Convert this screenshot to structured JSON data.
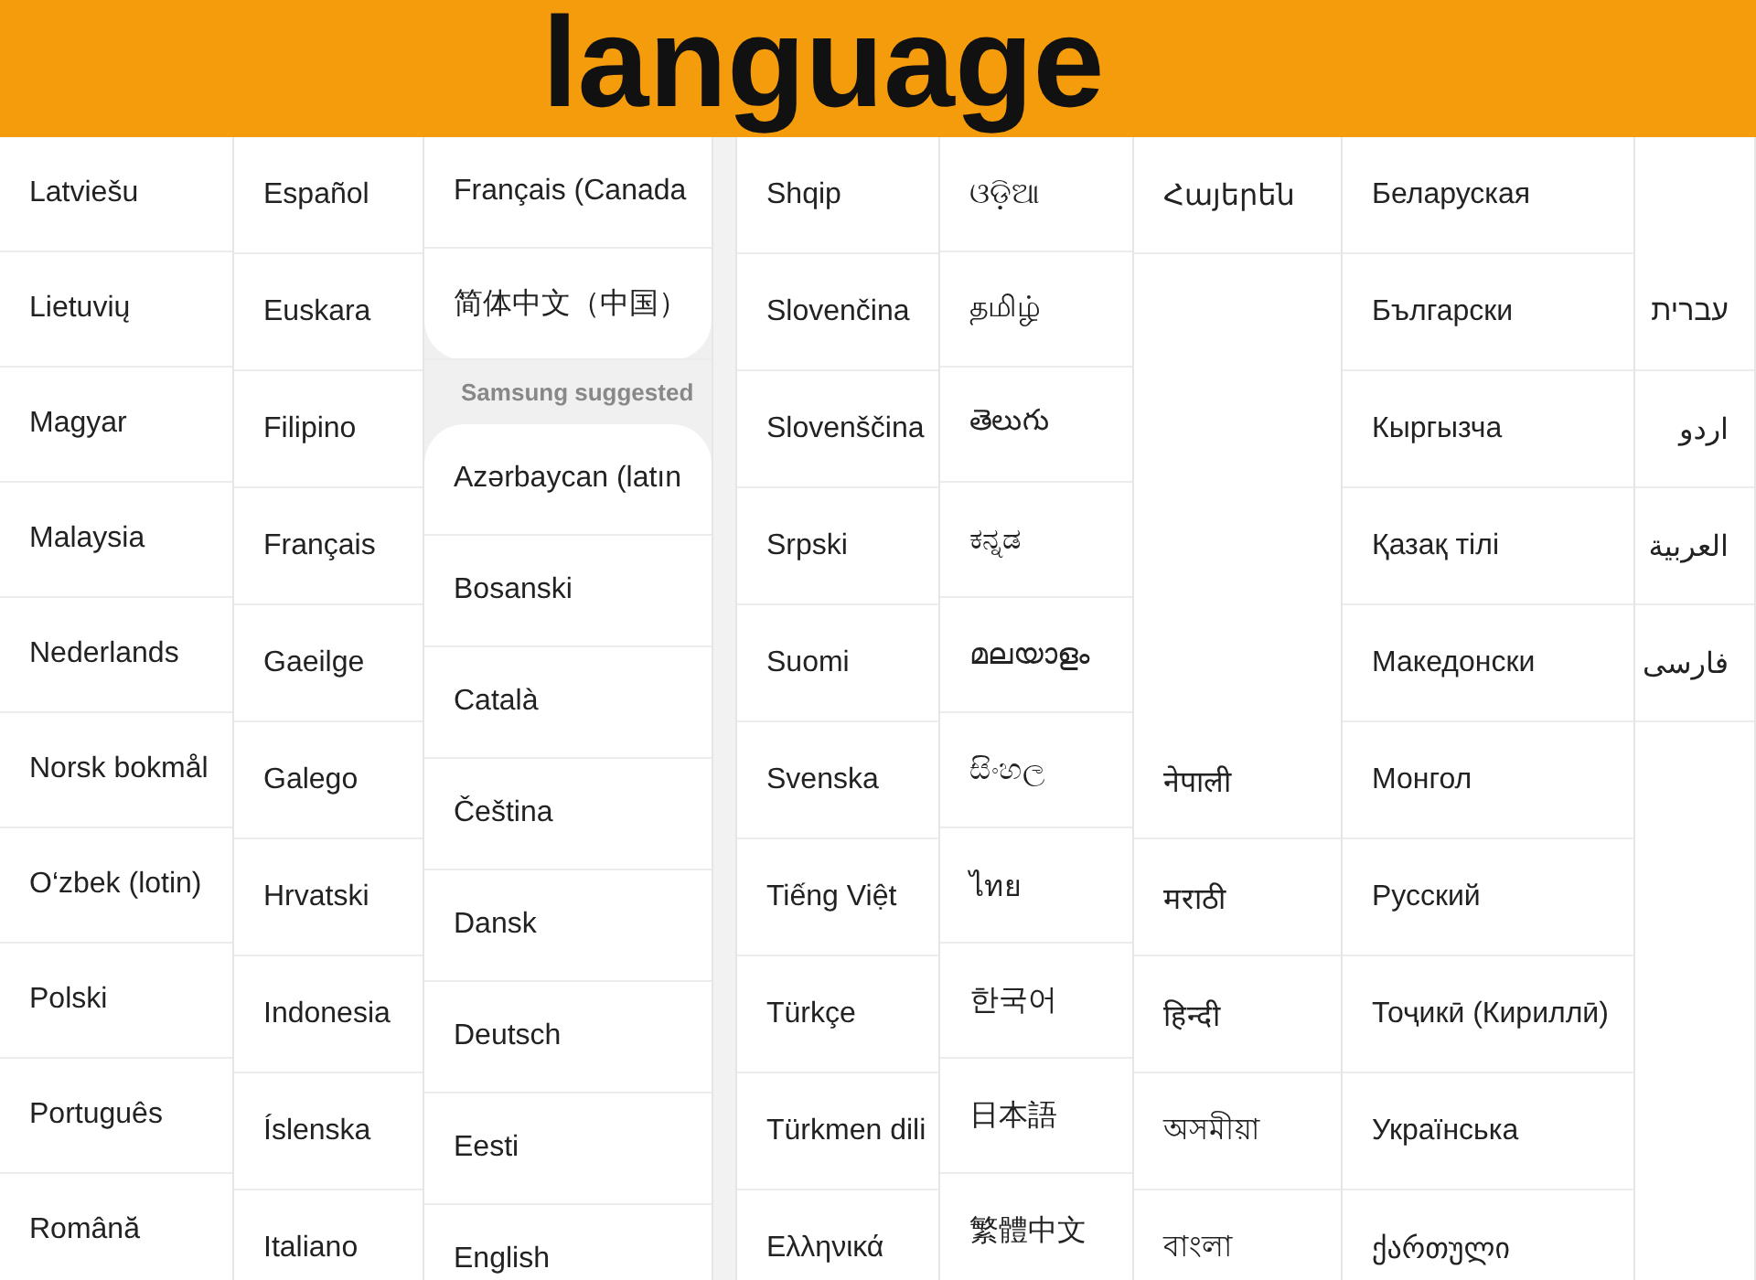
{
  "banner": {
    "title": "language"
  },
  "columns": [
    {
      "groups": [
        {
          "items": [
            "Latviešu",
            "Lietuvių",
            "Magyar",
            "Malaysia",
            "Nederlands",
            "Norsk bokmål",
            "O‘zbek (lotin)",
            "Polski",
            "Português",
            "Română"
          ]
        }
      ]
    },
    {
      "groups": [
        {
          "items": [
            "Español",
            "Euskara",
            "Filipino",
            "Français",
            "Gaeilge",
            "Galego",
            "Hrvatski",
            "Indonesia",
            "Íslenska",
            "Italiano"
          ]
        }
      ]
    },
    {
      "groups": [
        {
          "items": [
            "Français (Canada",
            "简体中文（中国）"
          ]
        },
        {
          "header": "Samsung suggested",
          "items": [
            "Azərbaycan (latın",
            "Bosanski",
            "Català",
            "Čeština",
            "Dansk",
            "Deutsch",
            "Eesti",
            "English"
          ]
        }
      ]
    },
    {
      "groups": [
        {
          "items": [
            "Shqip",
            "Slovenčina",
            "Slovenščina",
            "Srpski",
            "Suomi",
            "Svenska",
            "Tiếng Việt",
            "Türkçe",
            "Türkmen dili",
            "Ελληνικά"
          ]
        }
      ]
    },
    {
      "groups": [
        {
          "items": [
            "ଓଡ଼ିଆ",
            "தமிழ்",
            "తెలుగు",
            "ಕನ್ನಡ",
            "മലയാളം",
            "සිංහල",
            "ไทย",
            "한국어",
            "日本語",
            "繁體中文"
          ]
        }
      ]
    },
    {
      "groups": [
        {
          "items": [
            "Հայերեն"
          ]
        },
        {
          "items": [
            "नेपाली",
            "मराठी",
            "हिन्दी",
            "অসমীয়া",
            "বাংলা"
          ]
        }
      ]
    },
    {
      "groups": [
        {
          "items": [
            "Беларуская",
            "Български",
            "Кыргызча",
            "Қазақ тілі",
            "Македонски",
            "Монгол",
            "Русский",
            "Тоҷикӣ (Кириллӣ)",
            "Українська",
            "ქართული"
          ]
        }
      ]
    },
    {
      "groups": [
        {
          "items": [
            "עברית",
            "اردو",
            "العربية",
            "فارسی"
          ]
        }
      ]
    }
  ]
}
